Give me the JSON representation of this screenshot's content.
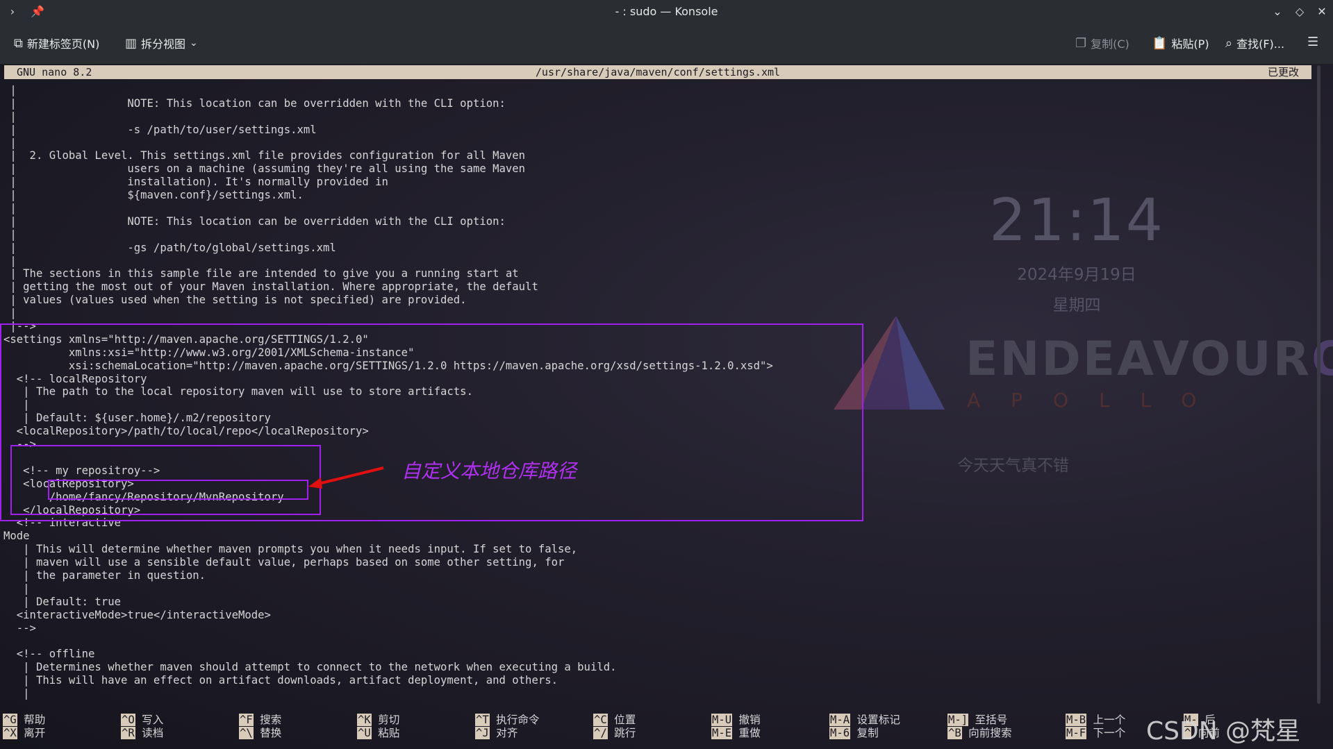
{
  "window": {
    "title": "- : sudo — Konsole"
  },
  "toolbar": {
    "new_tab": "新建标签页(N)",
    "split_view": "拆分视图",
    "copy": "复制(C)",
    "paste": "粘贴(P)",
    "find": "查找(F)..."
  },
  "nano": {
    "version": "GNU nano 8.2",
    "path": "/usr/share/java/maven/conf/settings.xml",
    "status": "已更改"
  },
  "editor": {
    "lines": [
      " |",
      " |                 NOTE: This location can be overridden with the CLI option:",
      " |",
      " |                 -s /path/to/user/settings.xml",
      " |",
      " |  2. Global Level. This settings.xml file provides configuration for all Maven",
      " |                 users on a machine (assuming they're all using the same Maven",
      " |                 installation). It's normally provided in",
      " |                 ${maven.conf}/settings.xml.",
      " |",
      " |                 NOTE: This location can be overridden with the CLI option:",
      " |",
      " |                 -gs /path/to/global/settings.xml",
      " |",
      " | The sections in this sample file are intended to give you a running start at",
      " | getting the most out of your Maven installation. Where appropriate, the default",
      " | values (values used when the setting is not specified) are provided.",
      " |",
      " |-->",
      "<settings xmlns=\"http://maven.apache.org/SETTINGS/1.2.0\"",
      "          xmlns:xsi=\"http://www.w3.org/2001/XMLSchema-instance\"",
      "          xsi:schemaLocation=\"http://maven.apache.org/SETTINGS/1.2.0 https://maven.apache.org/xsd/settings-1.2.0.xsd\">",
      "  <!-- localRepository",
      "   | The path to the local repository maven will use to store artifacts.",
      "   |",
      "   | Default: ${user.home}/.m2/repository",
      "  <localRepository>/path/to/local/repo</localRepository>",
      "  -->",
      "",
      "   <!-- my repositroy-->",
      "   <localRepository>",
      "       /home/fancy/Repository/MvnRepository",
      "   </localRepository>",
      "  <!-- interactive",
      "Mode",
      "   | This will determine whether maven prompts you when it needs input. If set to false,",
      "   | maven will use a sensible default value, perhaps based on some other setting, for",
      "   | the parameter in question.",
      "   |",
      "   | Default: true",
      "  <interactiveMode>true</interactiveMode>",
      "  -->",
      "",
      "  <!-- offline",
      "   | Determines whether maven should attempt to connect to the network when executing a build.",
      "   | This will have an effect on artifact downloads, artifact deployment, and others.",
      "   |"
    ]
  },
  "wallpaper": {
    "time": "21:14",
    "date": "2024年9月19日",
    "weekday": "星期四",
    "brand_main": "ENDEAVOUR",
    "brand_os": "OS",
    "brand_sub": "APOLLO",
    "weather": "今天天气真不错"
  },
  "annotation": {
    "note": "自定义本地仓库路径"
  },
  "shortcuts": [
    {
      "k1": "^G",
      "l1": "帮助",
      "k2": "^X",
      "l2": "离开"
    },
    {
      "k1": "^O",
      "l1": "写入",
      "k2": "^R",
      "l2": "读档"
    },
    {
      "k1": "^F",
      "l1": "搜索",
      "k2": "^\\",
      "l2": "替换"
    },
    {
      "k1": "^K",
      "l1": "剪切",
      "k2": "^U",
      "l2": "粘贴"
    },
    {
      "k1": "^T",
      "l1": "执行命令",
      "k2": "^J",
      "l2": "对齐"
    },
    {
      "k1": "^C",
      "l1": "位置",
      "k2": "^/",
      "l2": "跳行"
    },
    {
      "k1": "M-U",
      "l1": "撤销",
      "k2": "M-E",
      "l2": "重做"
    },
    {
      "k1": "M-A",
      "l1": "设置标记",
      "k2": "M-6",
      "l2": "复制"
    },
    {
      "k1": "M-]",
      "l1": "至括号",
      "k2": "^B",
      "l2": "向前搜索"
    },
    {
      "k1": "M-B",
      "l1": "上一个",
      "k2": "M-F",
      "l2": "下一个"
    },
    {
      "k1": "M-",
      "l1": "后",
      "k2": "^",
      "l2": "向前"
    }
  ],
  "watermark": "CSDN @梵星Lin"
}
